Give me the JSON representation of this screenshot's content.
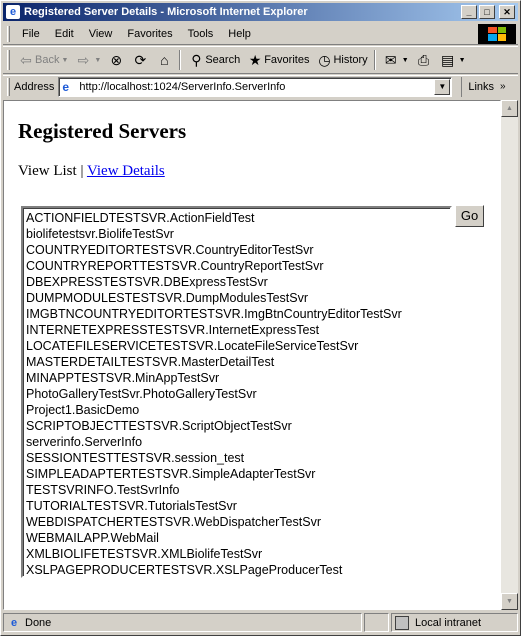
{
  "window": {
    "title": "Registered Server Details - Microsoft Internet Explorer",
    "minimize_icon": "minimize-icon",
    "maximize_icon": "maximize-icon",
    "close_icon": "close-icon"
  },
  "menu": [
    "File",
    "Edit",
    "View",
    "Favorites",
    "Tools",
    "Help"
  ],
  "toolbar": {
    "back": "Back",
    "search": "Search",
    "favorites": "Favorites",
    "history": "History"
  },
  "address": {
    "label": "Address",
    "url": "http://localhost:1024/ServerInfo.ServerInfo",
    "links": "Links"
  },
  "page": {
    "title": "Registered Servers",
    "view_list": "View List",
    "separator": "|",
    "view_details": "View Details",
    "go_label": "Go",
    "servers": [
      "ACTIONFIELDTESTSVR.ActionFieldTest",
      "biolifetestsvr.BiolifeTestSvr",
      "COUNTRYEDITORTESTSVR.CountryEditorTestSvr",
      "COUNTRYREPORTTESTSVR.CountryReportTestSvr",
      "DBEXPRESSTESTSVR.DBExpressTestSvr",
      "DUMPMODULESTESTSVR.DumpModulesTestSvr",
      "IMGBTNCOUNTRYEDITORTESTSVR.ImgBtnCountryEditorTestSvr",
      "INTERNETEXPRESSTESTSVR.InternetExpressTest",
      "LOCATEFILESERVICETESTSVR.LocateFileServiceTestSvr",
      "MASTERDETAILTESTSVR.MasterDetailTest",
      "MINAPPTESTSVR.MinAppTestSvr",
      "PhotoGalleryTestSvr.PhotoGalleryTestSvr",
      "Project1.BasicDemo",
      "SCRIPTOBJECTTESTSVR.ScriptObjectTestSvr",
      "serverinfo.ServerInfo",
      "SESSIONTESTTESTSVR.session_test",
      "SIMPLEADAPTERTESTSVR.SimpleAdapterTestSvr",
      "TESTSVRINFO.TestSvrInfo",
      "TUTORIALTESTSVR.TutorialsTestSvr",
      "WEBDISPATCHERTESTSVR.WebDispatcherTestSvr",
      "WEBMAILAPP.WebMail",
      "XMLBIOLIFETESTSVR.XMLBiolifeTestSvr",
      "XSLPAGEPRODUCERTESTSVR.XSLPageProducerTest"
    ]
  },
  "status": {
    "text": "Done",
    "zone": "Local intranet"
  },
  "colors": {
    "title_start": "#0a246a",
    "title_end": "#a6caf0",
    "link": "#0000ee",
    "chrome": "#d4d0c8"
  }
}
